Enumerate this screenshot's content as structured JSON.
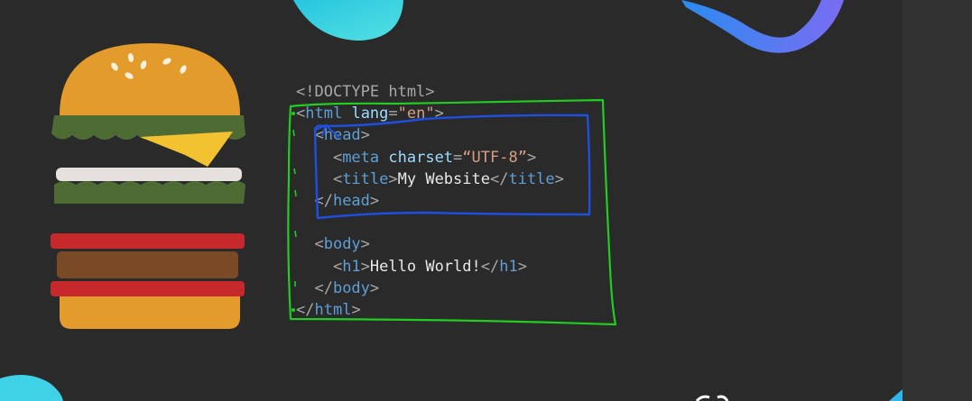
{
  "code_lines": [
    {
      "parts": [
        {
          "t": "<!DOCTYPE html>",
          "c": "punc"
        }
      ]
    },
    {
      "parts": [
        {
          "t": "<",
          "c": "punc"
        },
        {
          "t": "html",
          "c": "tag"
        },
        {
          "t": " ",
          "c": "txt"
        },
        {
          "t": "lang",
          "c": "attr"
        },
        {
          "t": "=",
          "c": "punc"
        },
        {
          "t": "\"en\"",
          "c": "str"
        },
        {
          "t": ">",
          "c": "punc"
        }
      ]
    },
    {
      "parts": [
        {
          "t": "  <",
          "c": "punc"
        },
        {
          "t": "head",
          "c": "tag"
        },
        {
          "t": ">",
          "c": "punc"
        }
      ]
    },
    {
      "parts": [
        {
          "t": "    <",
          "c": "punc"
        },
        {
          "t": "meta",
          "c": "tag"
        },
        {
          "t": " ",
          "c": "txt"
        },
        {
          "t": "charset",
          "c": "attr"
        },
        {
          "t": "=",
          "c": "punc"
        },
        {
          "t": "“UTF-8”",
          "c": "str"
        },
        {
          "t": ">",
          "c": "punc"
        }
      ]
    },
    {
      "parts": [
        {
          "t": "    <",
          "c": "punc"
        },
        {
          "t": "title",
          "c": "tag"
        },
        {
          "t": ">",
          "c": "punc"
        },
        {
          "t": "My Website",
          "c": "txt"
        },
        {
          "t": "</",
          "c": "punc"
        },
        {
          "t": "title",
          "c": "tag"
        },
        {
          "t": ">",
          "c": "punc"
        }
      ]
    },
    {
      "parts": [
        {
          "t": "  </",
          "c": "punc"
        },
        {
          "t": "head",
          "c": "tag"
        },
        {
          "t": ">",
          "c": "punc"
        }
      ]
    },
    {
      "parts": []
    },
    {
      "parts": [
        {
          "t": "  <",
          "c": "punc"
        },
        {
          "t": "body",
          "c": "tag"
        },
        {
          "t": ">",
          "c": "punc"
        }
      ]
    },
    {
      "parts": [
        {
          "t": "    <",
          "c": "punc"
        },
        {
          "t": "h1",
          "c": "tag"
        },
        {
          "t": ">",
          "c": "punc"
        },
        {
          "t": "Hello World!",
          "c": "txt"
        },
        {
          "t": "</",
          "c": "punc"
        },
        {
          "t": "h1",
          "c": "tag"
        },
        {
          "t": ">",
          "c": "punc"
        }
      ]
    },
    {
      "parts": [
        {
          "t": "  </",
          "c": "punc"
        },
        {
          "t": "body",
          "c": "tag"
        },
        {
          "t": ">",
          "c": "punc"
        }
      ]
    },
    {
      "parts": [
        {
          "t": "</",
          "c": "punc"
        },
        {
          "t": "html",
          "c": "tag"
        },
        {
          "t": ">",
          "c": "punc"
        }
      ]
    }
  ],
  "colors": {
    "background": "#2a2a2a",
    "tag": "#5e9fd6",
    "attribute": "#9cdcfe",
    "string": "#d69d85",
    "annotation_green": "#22cc22",
    "annotation_blue": "#1f4fe0"
  }
}
